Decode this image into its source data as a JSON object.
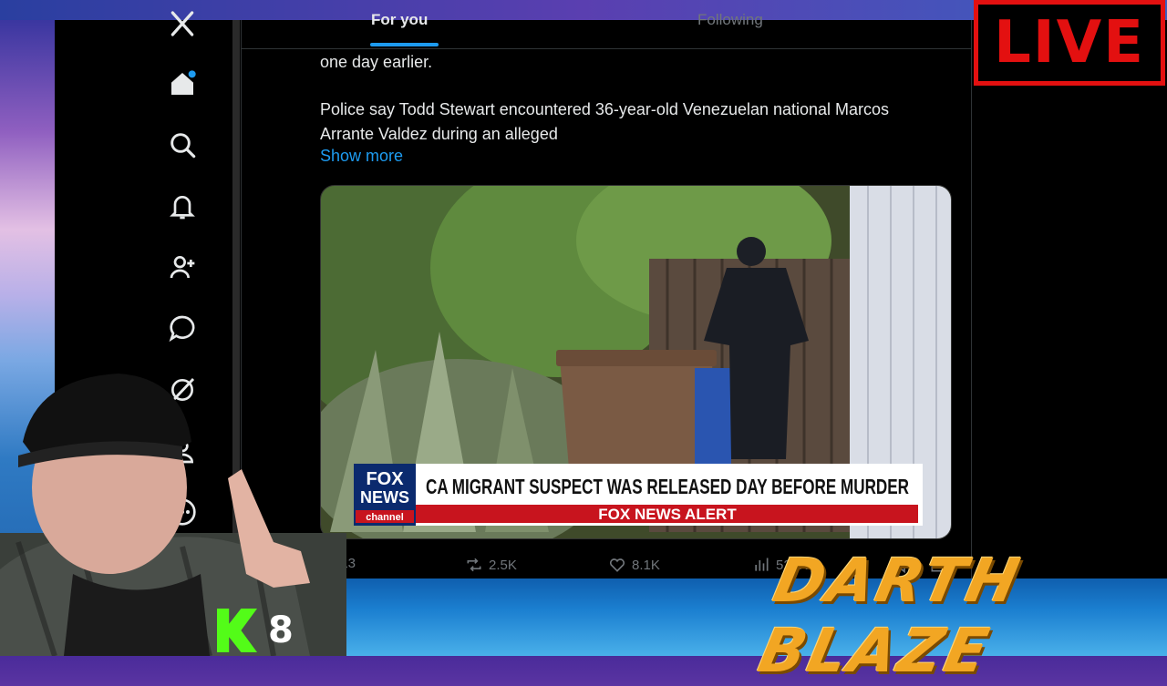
{
  "tabs": {
    "for_you": "For you",
    "following": "Following"
  },
  "post": {
    "line1": "one day earlier.",
    "para2_line1": "Police say Todd Stewart encountered 36-year-old Venezuelan national Marcos",
    "para2_line2": "Arrante Valdez during an alleged",
    "show_more": "Show more"
  },
  "media": {
    "chyron_headline": "CA MIGRANT SUSPECT WAS RELEASED DAY BEFORE MURDER",
    "chyron_alert": "FOX NEWS ALERT",
    "logo_line1": "FOX",
    "logo_line2": "NEWS",
    "logo_line3": "channel"
  },
  "actions": {
    "replies": "413",
    "reposts": "2.5K",
    "likes": "8.1K",
    "views": "525K"
  },
  "overlay": {
    "live": "LIVE",
    "streamer_name": "DARTH BLAZE",
    "kick_viewers": "8"
  },
  "colors": {
    "accent": "#1d9bf0",
    "live_red": "#e31010",
    "kick_green": "#53fc18",
    "blaze_orange": "#f2a623"
  },
  "nav_icons": [
    "x-logo-icon",
    "home-icon",
    "search-icon",
    "notifications-icon",
    "follow-icon",
    "messages-icon",
    "grok-icon",
    "profile-icon",
    "more-icon"
  ]
}
